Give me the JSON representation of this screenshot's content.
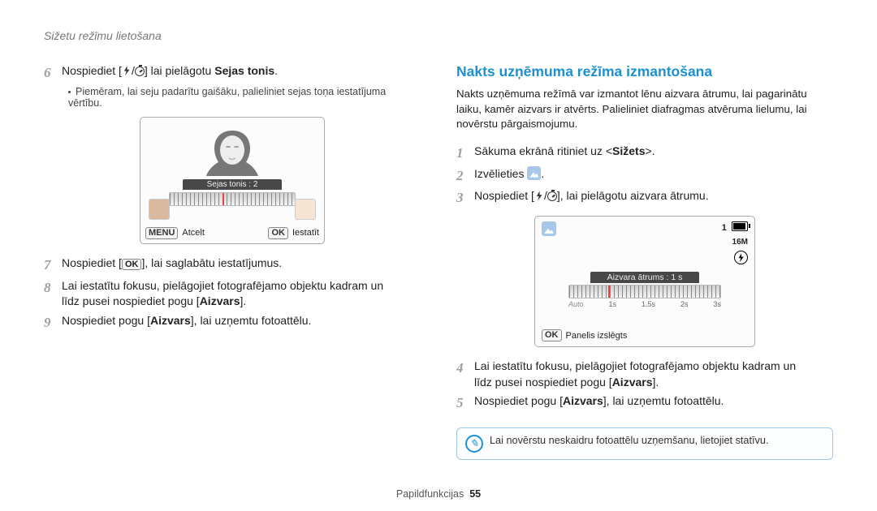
{
  "header": "Sižetu režīmu lietošana",
  "left": {
    "step6": {
      "num": "6",
      "text_before": "Nospiediet [",
      "text_mid": "/",
      "text_after": "] lai pielāgotu ",
      "bold": "Sejas tonis",
      "text_end": "."
    },
    "step6_note": "Piemēram, lai seju padarītu gaišāku, palieliniet sejas toņa iestatījuma vērtību.",
    "fig1": {
      "label": "Sejas tonis : 2",
      "menu_key": "MENU",
      "menu_text": "Atcelt",
      "ok_key": "OK",
      "ok_text": "Iestatīt"
    },
    "step7": {
      "num": "7",
      "before": "Nospiediet [",
      "ok": "OK",
      "after": "], lai saglabātu iestatījumus."
    },
    "step8": {
      "num": "8",
      "line1": "Lai iestatītu fokusu, pielāgojiet fotografējamo objektu kadram un",
      "line2_before": "līdz pusei nospiediet pogu [",
      "bold": "Aizvars",
      "line2_after": "]."
    },
    "step9": {
      "num": "9",
      "before": "Nospiediet pogu [",
      "bold": "Aizvars",
      "after": "], lai uzņemtu fotoattēlu."
    }
  },
  "right": {
    "heading": "Nakts uzņēmuma režīma izmantošana",
    "para": "Nakts uzņēmuma režīmā var izmantot lēnu aizvara ātrumu, lai pagarinātu laiku, kamēr aizvars ir atvērts. Palieliniet diafragmas atvēruma lielumu, lai novērstu pārgaismojumu.",
    "step1": {
      "num": "1",
      "before": "Sākuma ekrānā ritiniet uz <",
      "bold": "Sižets",
      "after": ">."
    },
    "step2": {
      "num": "2",
      "before": "Izvēlieties ",
      "after": "."
    },
    "step3": {
      "num": "3",
      "before": "Nospiediet [",
      "mid": "/",
      "after": "], lai pielāgotu aizvara ātrumu."
    },
    "fig2": {
      "top_num": "1",
      "top_res": "16M",
      "label": "Aizvara ātrums : 1 s",
      "ticks": [
        "Auto",
        "1s",
        "1.5s",
        "2s",
        "3s"
      ],
      "ok_key": "OK",
      "ok_text": "Panelis izslēgts"
    },
    "step4": {
      "num": "4",
      "line1": "Lai iestatītu fokusu, pielāgojiet fotografējamo objektu kadram un",
      "line2_before": "līdz pusei nospiediet pogu [",
      "bold": "Aizvars",
      "line2_after": "]."
    },
    "step5": {
      "num": "5",
      "before": "Nospiediet pogu [",
      "bold": "Aizvars",
      "after": "], lai uzņemtu fotoattēlu."
    },
    "note": "Lai novērstu neskaidru fotoattēlu uzņemšanu, lietojiet statīvu."
  },
  "footer": {
    "label": "Papildfunkcijas",
    "page": "55"
  }
}
